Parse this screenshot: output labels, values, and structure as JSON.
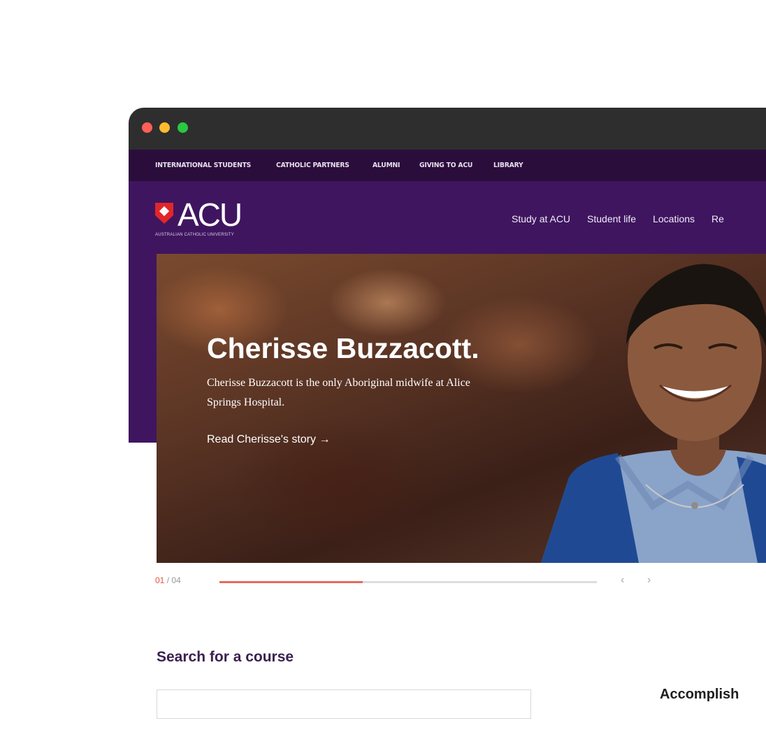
{
  "topbar": {
    "links": [
      "INTERNATIONAL STUDENTS",
      "CATHOLIC PARTNERS",
      "ALUMNI",
      "GIVING TO ACU",
      "LIBRARY"
    ]
  },
  "header": {
    "logo_text": "ACU",
    "logo_tagline": "AUSTRALIAN CATHOLIC UNIVERSITY",
    "nav": [
      "Study at ACU",
      "Student life",
      "Locations",
      "Re"
    ]
  },
  "hero": {
    "title": "Cherisse Buzzacott.",
    "description": "Cherisse Buzzacott is the only Aboriginal midwife at Alice Springs Hospital.",
    "link": "Read Cherisse's story →"
  },
  "slider": {
    "current": "01",
    "separator": "/",
    "total": "04",
    "progress": 0.38,
    "prev_icon": "‹",
    "next_icon": "›"
  },
  "search": {
    "title": "Search for a course"
  },
  "side": {
    "heading": "Accomplish"
  },
  "colors": {
    "topbar": "#2b0d3c",
    "brand_purple": "#3f1560",
    "accent_red": "#e1262a"
  }
}
